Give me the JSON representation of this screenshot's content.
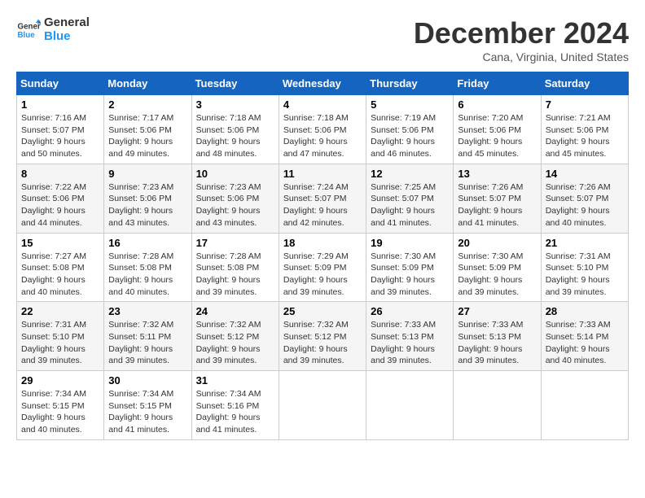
{
  "header": {
    "logo_general": "General",
    "logo_blue": "Blue",
    "month_title": "December 2024",
    "location": "Cana, Virginia, United States"
  },
  "calendar": {
    "weekdays": [
      "Sunday",
      "Monday",
      "Tuesday",
      "Wednesday",
      "Thursday",
      "Friday",
      "Saturday"
    ],
    "weeks": [
      [
        {
          "day": 1,
          "sunrise": "7:16 AM",
          "sunset": "5:07 PM",
          "daylight": "9 hours and 50 minutes."
        },
        {
          "day": 2,
          "sunrise": "7:17 AM",
          "sunset": "5:06 PM",
          "daylight": "9 hours and 49 minutes."
        },
        {
          "day": 3,
          "sunrise": "7:18 AM",
          "sunset": "5:06 PM",
          "daylight": "9 hours and 48 minutes."
        },
        {
          "day": 4,
          "sunrise": "7:18 AM",
          "sunset": "5:06 PM",
          "daylight": "9 hours and 47 minutes."
        },
        {
          "day": 5,
          "sunrise": "7:19 AM",
          "sunset": "5:06 PM",
          "daylight": "9 hours and 46 minutes."
        },
        {
          "day": 6,
          "sunrise": "7:20 AM",
          "sunset": "5:06 PM",
          "daylight": "9 hours and 45 minutes."
        },
        {
          "day": 7,
          "sunrise": "7:21 AM",
          "sunset": "5:06 PM",
          "daylight": "9 hours and 45 minutes."
        }
      ],
      [
        {
          "day": 8,
          "sunrise": "7:22 AM",
          "sunset": "5:06 PM",
          "daylight": "9 hours and 44 minutes."
        },
        {
          "day": 9,
          "sunrise": "7:23 AM",
          "sunset": "5:06 PM",
          "daylight": "9 hours and 43 minutes."
        },
        {
          "day": 10,
          "sunrise": "7:23 AM",
          "sunset": "5:06 PM",
          "daylight": "9 hours and 43 minutes."
        },
        {
          "day": 11,
          "sunrise": "7:24 AM",
          "sunset": "5:07 PM",
          "daylight": "9 hours and 42 minutes."
        },
        {
          "day": 12,
          "sunrise": "7:25 AM",
          "sunset": "5:07 PM",
          "daylight": "9 hours and 41 minutes."
        },
        {
          "day": 13,
          "sunrise": "7:26 AM",
          "sunset": "5:07 PM",
          "daylight": "9 hours and 41 minutes."
        },
        {
          "day": 14,
          "sunrise": "7:26 AM",
          "sunset": "5:07 PM",
          "daylight": "9 hours and 40 minutes."
        }
      ],
      [
        {
          "day": 15,
          "sunrise": "7:27 AM",
          "sunset": "5:08 PM",
          "daylight": "9 hours and 40 minutes."
        },
        {
          "day": 16,
          "sunrise": "7:28 AM",
          "sunset": "5:08 PM",
          "daylight": "9 hours and 40 minutes."
        },
        {
          "day": 17,
          "sunrise": "7:28 AM",
          "sunset": "5:08 PM",
          "daylight": "9 hours and 39 minutes."
        },
        {
          "day": 18,
          "sunrise": "7:29 AM",
          "sunset": "5:09 PM",
          "daylight": "9 hours and 39 minutes."
        },
        {
          "day": 19,
          "sunrise": "7:30 AM",
          "sunset": "5:09 PM",
          "daylight": "9 hours and 39 minutes."
        },
        {
          "day": 20,
          "sunrise": "7:30 AM",
          "sunset": "5:09 PM",
          "daylight": "9 hours and 39 minutes."
        },
        {
          "day": 21,
          "sunrise": "7:31 AM",
          "sunset": "5:10 PM",
          "daylight": "9 hours and 39 minutes."
        }
      ],
      [
        {
          "day": 22,
          "sunrise": "7:31 AM",
          "sunset": "5:10 PM",
          "daylight": "9 hours and 39 minutes."
        },
        {
          "day": 23,
          "sunrise": "7:32 AM",
          "sunset": "5:11 PM",
          "daylight": "9 hours and 39 minutes."
        },
        {
          "day": 24,
          "sunrise": "7:32 AM",
          "sunset": "5:12 PM",
          "daylight": "9 hours and 39 minutes."
        },
        {
          "day": 25,
          "sunrise": "7:32 AM",
          "sunset": "5:12 PM",
          "daylight": "9 hours and 39 minutes."
        },
        {
          "day": 26,
          "sunrise": "7:33 AM",
          "sunset": "5:13 PM",
          "daylight": "9 hours and 39 minutes."
        },
        {
          "day": 27,
          "sunrise": "7:33 AM",
          "sunset": "5:13 PM",
          "daylight": "9 hours and 39 minutes."
        },
        {
          "day": 28,
          "sunrise": "7:33 AM",
          "sunset": "5:14 PM",
          "daylight": "9 hours and 40 minutes."
        }
      ],
      [
        {
          "day": 29,
          "sunrise": "7:34 AM",
          "sunset": "5:15 PM",
          "daylight": "9 hours and 40 minutes."
        },
        {
          "day": 30,
          "sunrise": "7:34 AM",
          "sunset": "5:15 PM",
          "daylight": "9 hours and 41 minutes."
        },
        {
          "day": 31,
          "sunrise": "7:34 AM",
          "sunset": "5:16 PM",
          "daylight": "9 hours and 41 minutes."
        },
        null,
        null,
        null,
        null
      ]
    ]
  }
}
